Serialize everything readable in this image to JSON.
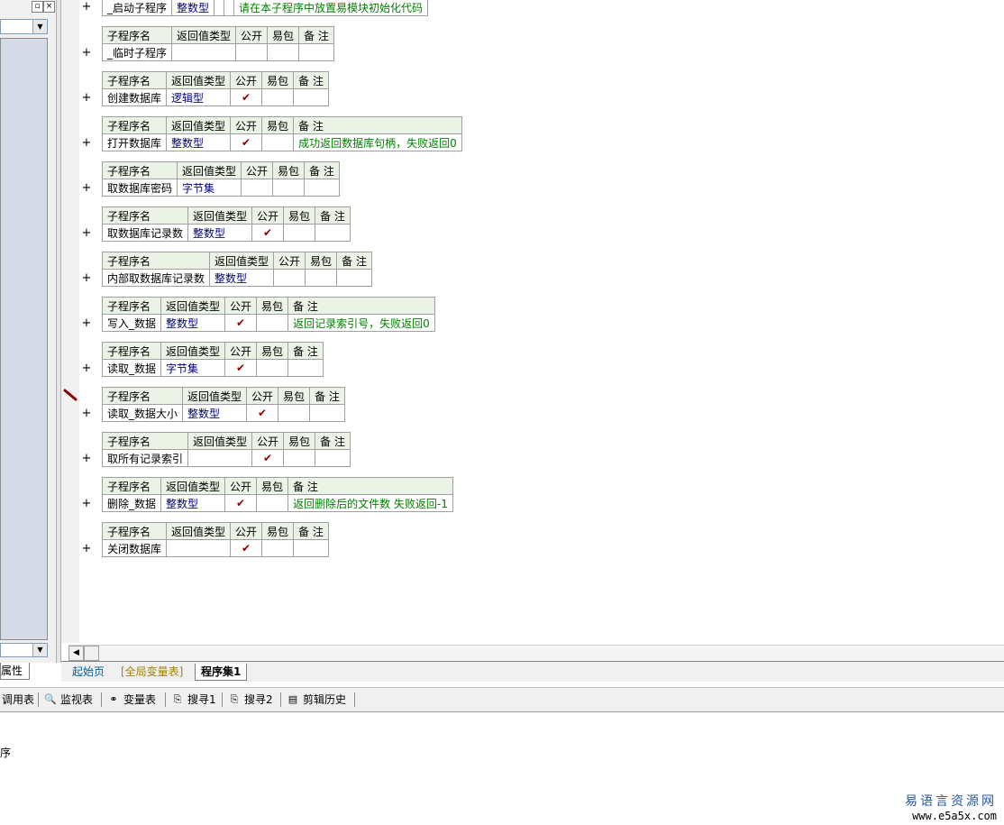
{
  "left_panel": {
    "props_tab": "属性"
  },
  "subroutines": [
    {
      "name": "_启动子程序",
      "type": "整数型",
      "public": "",
      "easy": "",
      "note": "请在本子程序中放置易模块初始化代码",
      "header": false
    },
    {
      "name": "_临时子程序",
      "type": "",
      "public": "",
      "easy": "",
      "note": "",
      "header": true
    },
    {
      "name": "创建数据库",
      "type": "逻辑型",
      "public": "✔",
      "easy": "",
      "note": "",
      "header": true
    },
    {
      "name": "打开数据库",
      "type": "整数型",
      "public": "✔",
      "easy": "",
      "note": "成功返回数据库句柄，失败返回0",
      "header": true
    },
    {
      "name": "取数据库密码",
      "type": "字节集",
      "public": "",
      "easy": "",
      "note": "",
      "header": true
    },
    {
      "name": "取数据库记录数",
      "type": "整数型",
      "public": "✔",
      "easy": "",
      "note": "",
      "header": true
    },
    {
      "name": "内部取数据库记录数",
      "type": "整数型",
      "public": "",
      "easy": "",
      "note": "",
      "header": true
    },
    {
      "name": "写入_数据",
      "type": "整数型",
      "public": "✔",
      "easy": "",
      "note": "返回记录索引号，失败返回0",
      "header": true
    },
    {
      "name": "读取_数据",
      "type": "字节集",
      "public": "✔",
      "easy": "",
      "note": "",
      "header": true
    },
    {
      "name": "读取_数据大小",
      "type": "整数型",
      "public": "✔",
      "easy": "",
      "note": "",
      "header": true
    },
    {
      "name": "取所有记录索引",
      "type": "",
      "public": "✔",
      "easy": "",
      "note": "",
      "header": true
    },
    {
      "name": "删除_数据",
      "type": "整数型",
      "public": "✔",
      "easy": "",
      "note": "返回删除后的文件数 失败返回-1",
      "header": true
    },
    {
      "name": "关闭数据库",
      "type": "",
      "public": "✔",
      "easy": "",
      "note": "",
      "header": true
    }
  ],
  "headers": {
    "name": "子程序名",
    "type": "返回值类型",
    "public": "公开",
    "easy": "易包",
    "note": "备 注"
  },
  "tabs": {
    "start": "起始页",
    "global": "[全局变量表]",
    "prog": "程序集1"
  },
  "toolbar": {
    "calltable": "调用表",
    "monitor": "监视表",
    "vars": "变量表",
    "search1": "搜寻1",
    "search2": "搜寻2",
    "cliphist": "剪辑历史"
  },
  "status": "序",
  "watermark": {
    "line1": "易语言资源网",
    "line2": "www.e5a5x.com"
  }
}
